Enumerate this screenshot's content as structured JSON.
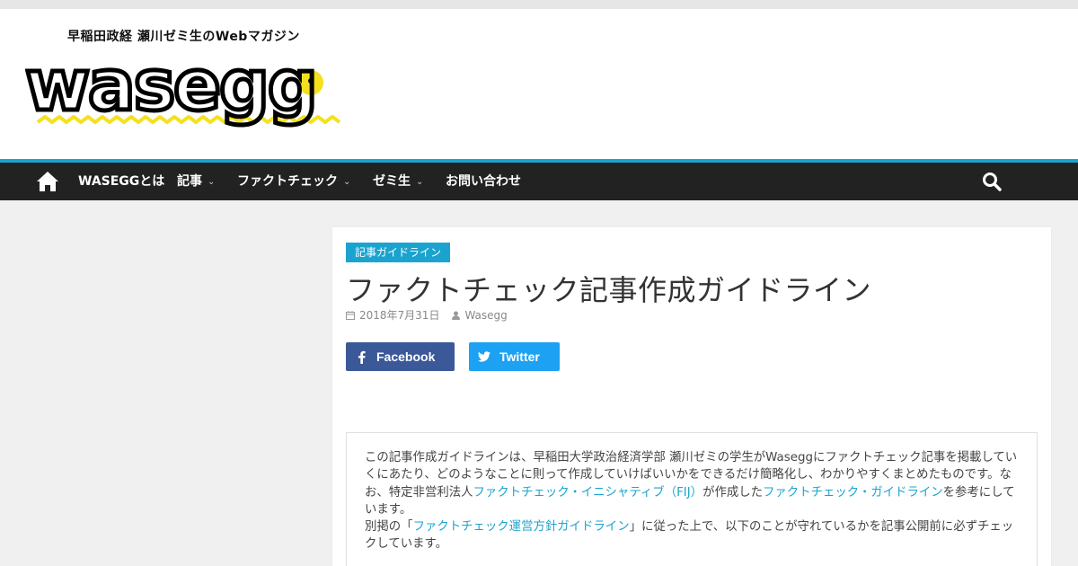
{
  "header": {
    "tagline": "早稲田政経 瀬川ゼミ生のWebマガジン",
    "logo_text": "wasegg",
    "logo_accent_color": "#f5e020"
  },
  "nav": {
    "home_icon": "home-icon",
    "items": [
      {
        "label": "WASEGGとは"
      },
      {
        "label": "記事"
      },
      {
        "label": "ファクトチェック"
      },
      {
        "label": "ゼミ生"
      },
      {
        "label": "お問い合わせ"
      }
    ],
    "search_icon": "search-icon",
    "accent_color": "#1ba3cf"
  },
  "article": {
    "category": "記事ガイドライン",
    "title": "ファクトチェック記事作成ガイドライン",
    "date": "2018年7月31日",
    "author": "Wasegg",
    "share": {
      "facebook": "Facebook",
      "twitter": "Twitter"
    },
    "intro": {
      "p1_a": "この記事作成ガイドラインは、早稲田大学政治経済学部 瀬川ゼミの学生がWaseggにファクトチェック記事を掲載していくにあたり、どのようなことに則って作成していけばいいかをできるだけ簡略化し、わかりやすくまとめたものです。なお、特定非営利法人",
      "link1": "ファクトチェック・イニシャティブ（FIJ）",
      "p1_b": "が作成した",
      "link2": "ファクトチェック・ガイドライン",
      "p1_c": "を参考にしています。",
      "p2_a": "別掲の「",
      "link3": "ファクトチェック運営方針ガイドライン",
      "p2_b": "」に従った上で、以下のことが守れているかを記事公開前に必ずチェックしています。"
    }
  }
}
